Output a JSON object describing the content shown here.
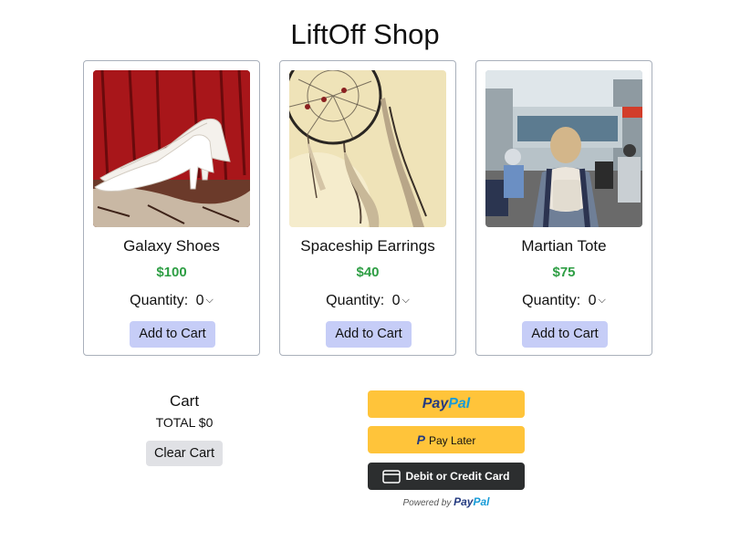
{
  "page": {
    "title": "LiftOff Shop"
  },
  "products": [
    {
      "name": "Galaxy Shoes",
      "price": "$100",
      "quantity_label": "Quantity:",
      "quantity_value": "0",
      "add_label": "Add to Cart",
      "image": "white-high-heel-shoes-photo"
    },
    {
      "name": "Spaceship Earrings",
      "price": "$40",
      "quantity_label": "Quantity:",
      "quantity_value": "0",
      "add_label": "Add to Cart",
      "image": "dreamcatcher-photo"
    },
    {
      "name": "Martian Tote",
      "price": "$75",
      "quantity_label": "Quantity:",
      "quantity_value": "0",
      "add_label": "Add to Cart",
      "image": "street-traveler-photo"
    }
  ],
  "cart": {
    "title": "Cart",
    "total": "TOTAL $0",
    "clear_label": "Clear Cart"
  },
  "payment": {
    "paypal_brand_a": "Pay",
    "paypal_brand_b": "Pal",
    "pay_later_label": "Pay Later",
    "card_label": "Debit or Credit Card",
    "powered_by": "Powered by"
  },
  "colors": {
    "price_green": "#2e9e44",
    "add_button": "#c6cdf7",
    "paypal_yellow": "#ffc43a",
    "card_button": "#2c2e2f",
    "paypal_dark_blue": "#253b80",
    "paypal_light_blue": "#179bd7"
  }
}
